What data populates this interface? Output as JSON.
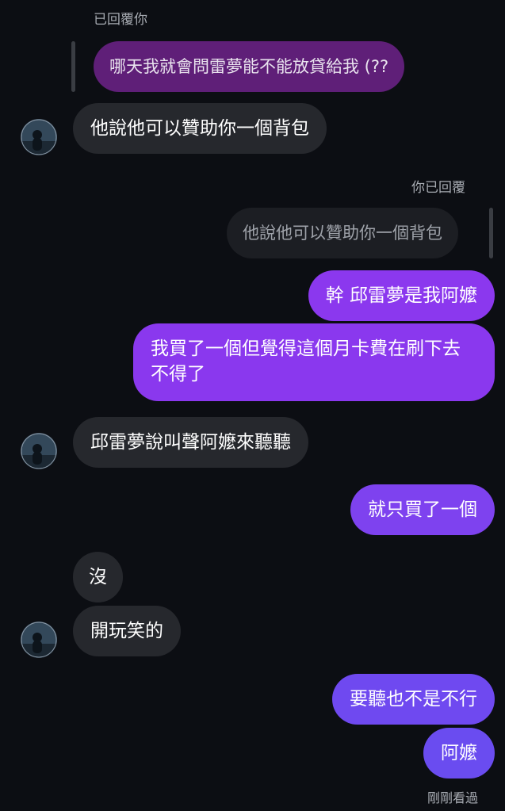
{
  "thread": {
    "reply_label_them": "已回覆你",
    "reply_label_me": "你已回覆",
    "seen_label": "剛剛看過",
    "colors": {
      "background": "#0c0e13",
      "incoming": "#26282d",
      "outgoing_top": "#8e35ee",
      "outgoing_bottom": "#6a4cf0"
    },
    "messages": [
      {
        "id": "quoted_them",
        "text": "哪天我就會問雷夢能不能放貸給我 (??",
        "side": "in",
        "quoted": true
      },
      {
        "id": "m1",
        "text": "他說他可以贊助你一個背包",
        "side": "in"
      },
      {
        "id": "quoted_me",
        "text": "他說他可以贊助你一個背包",
        "side": "out",
        "quoted": true
      },
      {
        "id": "m2",
        "text": "幹 邱雷夢是我阿嬤",
        "side": "out"
      },
      {
        "id": "m3",
        "text": "我買了一個但覺得這個月卡費在刷下去不得了",
        "side": "out"
      },
      {
        "id": "m4",
        "text": "邱雷夢說叫聲阿嬤來聽聽",
        "side": "in"
      },
      {
        "id": "m5",
        "text": "就只買了一個",
        "side": "out"
      },
      {
        "id": "m6",
        "text": "沒",
        "side": "in"
      },
      {
        "id": "m7",
        "text": "開玩笑的",
        "side": "in"
      },
      {
        "id": "m8",
        "text": "要聽也不是不行",
        "side": "out"
      },
      {
        "id": "m9",
        "text": "阿嬤",
        "side": "out"
      }
    ]
  }
}
